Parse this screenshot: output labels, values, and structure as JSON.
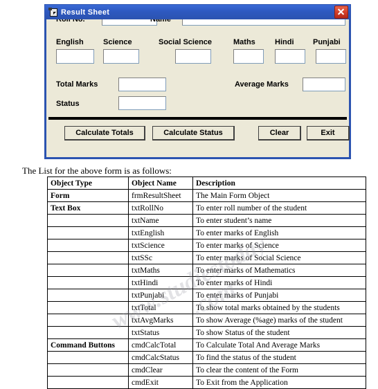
{
  "window": {
    "title": "Result Sheet",
    "icon": "form-sheet-icon",
    "close_label": "x",
    "border_color": "#2b53b0",
    "titlebar_color": "#2e59c0",
    "body_color": "#ece9d8",
    "close_color": "#d4402a"
  },
  "form": {
    "fields": [
      {
        "label": "Roll No.",
        "value": "",
        "name": "roll-no"
      },
      {
        "label": "Name",
        "value": "",
        "name": "name"
      },
      {
        "label": "English",
        "value": "",
        "name": "english"
      },
      {
        "label": "Science",
        "value": "",
        "name": "science"
      },
      {
        "label": "Social Science",
        "value": "",
        "name": "social-science"
      },
      {
        "label": "Maths",
        "value": "",
        "name": "maths"
      },
      {
        "label": "Hindi",
        "value": "",
        "name": "hindi"
      },
      {
        "label": "Punjabi",
        "value": "",
        "name": "punjabi"
      },
      {
        "label": "Total Marks",
        "value": "",
        "name": "total-marks"
      },
      {
        "label": "Average Marks",
        "value": "",
        "name": "average-marks"
      },
      {
        "label": "Status",
        "value": "",
        "name": "status"
      }
    ],
    "buttons": [
      {
        "label": "Calculate Totals",
        "name": "calculate-totals"
      },
      {
        "label": "Calculate Status",
        "name": "calculate-status"
      },
      {
        "label": "Clear",
        "name": "clear"
      },
      {
        "label": "Exit",
        "name": "exit"
      }
    ]
  },
  "caption": "The List for the above form is as follows:",
  "table": {
    "headers": [
      "Object Type",
      "Object Name",
      "Description"
    ],
    "rows": [
      {
        "type": "Form",
        "name": "frmResultSheet",
        "desc": "The Main Form Object"
      },
      {
        "type": "Text Box",
        "name": "txtRollNo",
        "desc": "To enter roll number of the student"
      },
      {
        "type": "",
        "name": "txtName",
        "desc": "To enter student’s name"
      },
      {
        "type": "",
        "name": "txtEnglish",
        "desc": "To enter marks of English"
      },
      {
        "type": "",
        "name": "txtScience",
        "desc": "To enter marks of Science"
      },
      {
        "type": "",
        "name": "txtSSc",
        "desc": "To enter marks of Social Science"
      },
      {
        "type": "",
        "name": "txtMaths",
        "desc": "To enter marks of Mathematics"
      },
      {
        "type": "",
        "name": "txtHindi",
        "desc": "To enter marks of Hindi"
      },
      {
        "type": "",
        "name": "txtPunjabi",
        "desc": "To enter marks of Punjabi"
      },
      {
        "type": "",
        "name": "txtTotal",
        "desc": "To show total marks obtained by the students"
      },
      {
        "type": "",
        "name": "txtAvgMarks",
        "desc": "To show Average (%age) marks of the student"
      },
      {
        "type": "",
        "name": "txtStatus",
        "desc": "To show Status of the student"
      },
      {
        "type": "Command Buttons",
        "name": "cmdCalcTotal",
        "desc": "To Calculate Total And Average Marks"
      },
      {
        "type": "",
        "name": "cmdCalcStatus",
        "desc": "To find the status of the student"
      },
      {
        "type": "",
        "name": "cmdClear",
        "desc": "To clear the content of the Form"
      },
      {
        "type": "",
        "name": "cmdExit",
        "desc": "To Exit from the Application"
      }
    ]
  },
  "watermark": {
    "line1": "www.studiestoday",
    "line2": ".com"
  }
}
